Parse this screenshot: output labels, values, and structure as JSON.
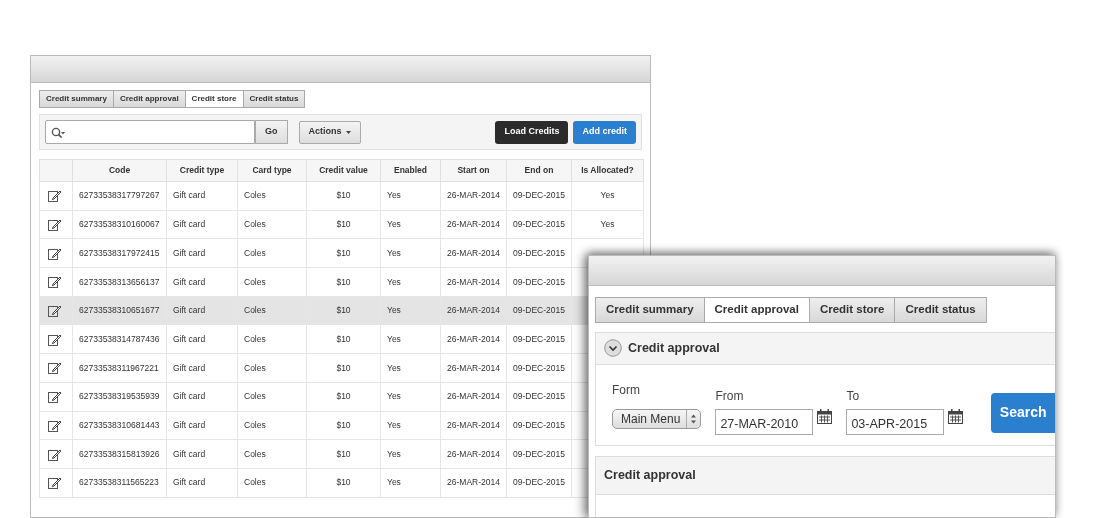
{
  "back_window": {
    "tabs": [
      {
        "label": "Credit summary",
        "selected": false
      },
      {
        "label": "Credit approval",
        "selected": false
      },
      {
        "label": "Credit store",
        "selected": true
      },
      {
        "label": "Credit status",
        "selected": false
      }
    ],
    "toolbar": {
      "go": "Go",
      "actions": "Actions",
      "load": "Load Credits",
      "add": "Add credit"
    },
    "table": {
      "columns": [
        "Code",
        "Credit type",
        "Card type",
        "Credit value",
        "Enabled",
        "Start on",
        "End on",
        "Is Allocated?"
      ],
      "rows": [
        {
          "selected": false,
          "cells": [
            "62733538317797267",
            "Gift card",
            "Coles",
            "$10",
            "Yes",
            "26-MAR-2014",
            "09-DEC-2015",
            "Yes"
          ]
        },
        {
          "selected": false,
          "cells": [
            "62733538310160067",
            "Gift card",
            "Coles",
            "$10",
            "Yes",
            "26-MAR-2014",
            "09-DEC-2015",
            "Yes"
          ]
        },
        {
          "selected": false,
          "cells": [
            "62733538317972415",
            "Gift card",
            "Coles",
            "$10",
            "Yes",
            "26-MAR-2014",
            "09-DEC-2015"
          ]
        },
        {
          "selected": false,
          "cells": [
            "62733538313656137",
            "Gift card",
            "Coles",
            "$10",
            "Yes",
            "26-MAR-2014",
            "09-DEC-2015"
          ]
        },
        {
          "selected": true,
          "cells": [
            "62733538310651677",
            "Gift card",
            "Coles",
            "$10",
            "Yes",
            "26-MAR-2014",
            "09-DEC-2015"
          ]
        },
        {
          "selected": false,
          "cells": [
            "62733538314787436",
            "Gift card",
            "Coles",
            "$10",
            "Yes",
            "26-MAR-2014",
            "09-DEC-2015"
          ]
        },
        {
          "selected": false,
          "cells": [
            "62733538311967221",
            "Gift card",
            "Coles",
            "$10",
            "Yes",
            "26-MAR-2014",
            "09-DEC-2015"
          ]
        },
        {
          "selected": false,
          "cells": [
            "62733538319535939",
            "Gift card",
            "Coles",
            "$10",
            "Yes",
            "26-MAR-2014",
            "09-DEC-2015"
          ]
        },
        {
          "selected": false,
          "cells": [
            "62733538310681443",
            "Gift card",
            "Coles",
            "$10",
            "Yes",
            "26-MAR-2014",
            "09-DEC-2015"
          ]
        },
        {
          "selected": false,
          "cells": [
            "62733538315813926",
            "Gift card",
            "Coles",
            "$10",
            "Yes",
            "26-MAR-2014",
            "09-DEC-2015"
          ]
        },
        {
          "selected": false,
          "cells": [
            "62733538311565223",
            "Gift card",
            "Coles",
            "$10",
            "Yes",
            "26-MAR-2014",
            "09-DEC-2015"
          ]
        }
      ]
    }
  },
  "front_window": {
    "tabs": [
      {
        "label": "Credit summary",
        "selected": false
      },
      {
        "label": "Credit approval",
        "selected": true
      },
      {
        "label": "Credit store",
        "selected": false
      },
      {
        "label": "Credit status",
        "selected": false
      }
    ],
    "filter_panel": {
      "title": "Credit approval",
      "expanded": true,
      "form_label": "Form",
      "form_value": "Main Menu",
      "from_label": "From",
      "from_value": "27-MAR-2010",
      "to_label": "To",
      "to_value": "03-APR-2015",
      "search": "Search"
    },
    "results_panel": {
      "title": "Credit approval"
    }
  }
}
